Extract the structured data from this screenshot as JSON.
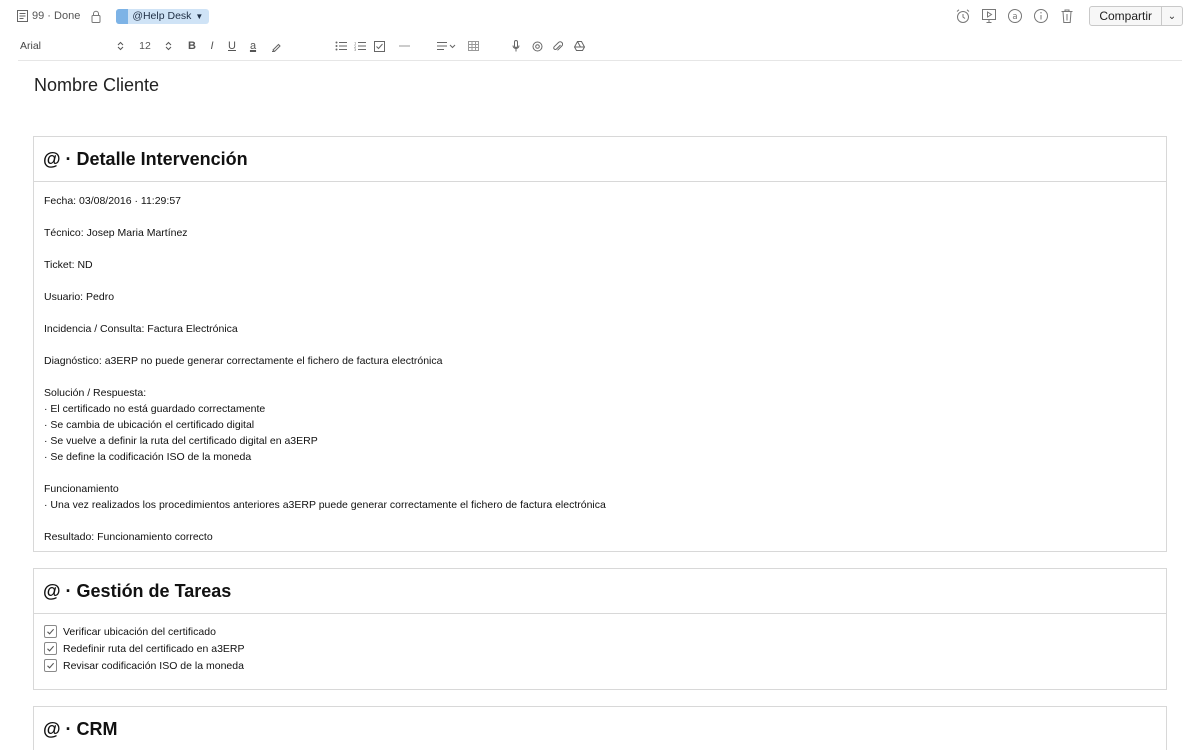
{
  "header": {
    "status": "99 · Done",
    "tag": "@Help Desk",
    "share_label": "Compartir"
  },
  "toolbar": {
    "font": "Arial",
    "size": "12",
    "bold": "B",
    "italic": "I",
    "underline": "U",
    "text_color": "a"
  },
  "document": {
    "title": "Nombre Cliente"
  },
  "sections": {
    "detail": {
      "heading": "@ · Detalle Intervención",
      "fecha": "Fecha: 03/08/2016 · 11:29:57",
      "tecnico": "Técnico: Josep Maria Martínez",
      "ticket": "Ticket: ND",
      "usuario": "Usuario: Pedro",
      "incidencia": "Incidencia / Consulta: Factura Electrónica",
      "diagnostico": "Diagnóstico: a3ERP no puede generar correctamente el fichero de factura electrónica",
      "solucion_title": "Solución / Respuesta:",
      "solucion_items": [
        "· El certificado no está guardado correctamente",
        "· Se cambia de ubicación el certificado digital",
        "· Se vuelve a definir la ruta del certificado digital en a3ERP",
        "· Se define la codificación ISO de la moneda"
      ],
      "funcionamiento_title": "Funcionamiento",
      "funcionamiento_items": [
        "· Una vez realizados los procedimientos anteriores a3ERP puede generar correctamente el fichero de factura electrónica"
      ],
      "resultado": "Resultado: Funcionamiento correcto"
    },
    "tasks": {
      "heading": "@ · Gestión de Tareas",
      "items": [
        "Verificar ubicación del certificado",
        "Redefinir ruta del certificado en a3ERP",
        "Revisar codificación ISO de la moneda"
      ]
    },
    "crm": {
      "heading": "@ · CRM"
    }
  },
  "colors": {
    "tag_bg": "#cfe3f6",
    "tag_accent": "#7db3e6",
    "border": "#d8d8d8"
  }
}
